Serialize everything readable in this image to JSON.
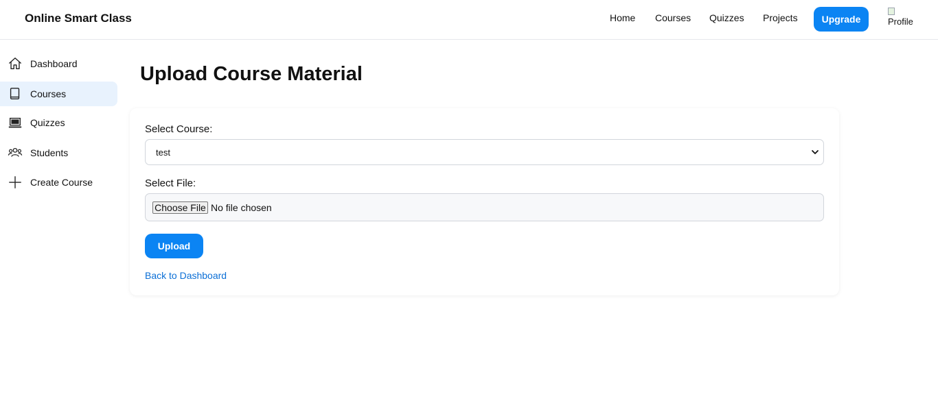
{
  "header": {
    "brand": "Online Smart Class",
    "nav": [
      {
        "label": "Home"
      },
      {
        "label": "Courses"
      },
      {
        "label": "Quizzes"
      },
      {
        "label": "Projects"
      }
    ],
    "upgrade_label": "Upgrade",
    "avatar_alt": "Profile"
  },
  "sidebar": {
    "items": [
      {
        "label": "Dashboard",
        "icon": "home-icon"
      },
      {
        "label": "Courses",
        "icon": "book-icon",
        "active": true
      },
      {
        "label": "Quizzes",
        "icon": "laptop-icon"
      },
      {
        "label": "Students",
        "icon": "users-icon"
      },
      {
        "label": "Create Course",
        "icon": "plus-icon"
      }
    ]
  },
  "main": {
    "title": "Upload Course Material",
    "course_label": "Select Course:",
    "course_selected": "test",
    "file_label": "Select File:",
    "choose_file_label": "Choose File",
    "no_file_text": "No file chosen",
    "upload_label": "Upload",
    "back_link": "Back to Dashboard"
  },
  "colors": {
    "accent": "#0b84f3",
    "active_bg": "#e8f2fd",
    "link": "#0b6fd6"
  }
}
